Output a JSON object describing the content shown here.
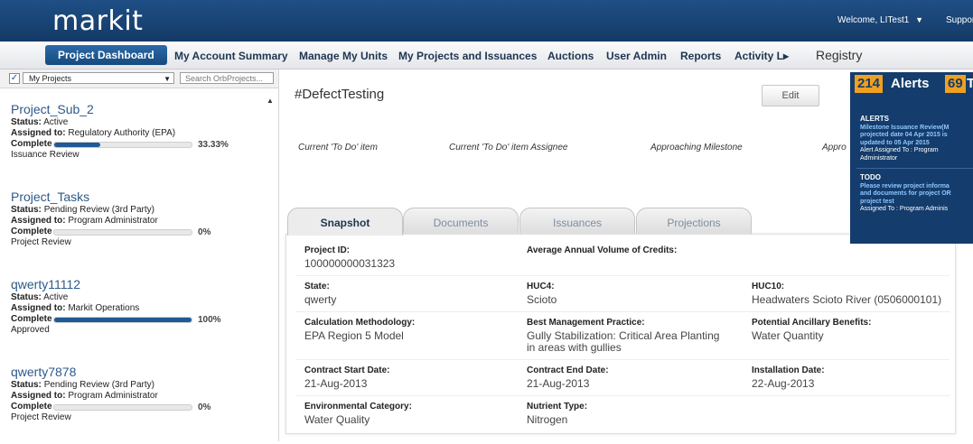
{
  "header": {
    "logo": "markit",
    "welcome": "Welcome, LITest1",
    "welcome_caret": "▼",
    "support": "Suppor"
  },
  "nav": {
    "items": [
      "Project Dashboard",
      "My Account Summary",
      "Manage My Units",
      "My Projects and Issuances",
      "Auctions",
      "User Admin",
      "Reports",
      "Activity L▸"
    ],
    "active": "Project Dashboard",
    "registry": "Registry"
  },
  "filter": {
    "checked": true,
    "select_value": "My Projects",
    "search_placeholder": "Search OrbProjects..."
  },
  "projects": [
    {
      "name": "Project_Sub_2",
      "status_label": "Status:",
      "status": "Active",
      "assigned_label": "Assigned to:",
      "assigned": "Regulatory Authority (EPA)",
      "complete_label": "Complete",
      "percent": "33.33%",
      "progress": 0.3333,
      "stage": "Issuance Review"
    },
    {
      "name": "Project_Tasks",
      "status_label": "Status:",
      "status": "Pending Review (3rd Party)",
      "assigned_label": "Assigned to:",
      "assigned": "Program Administrator",
      "complete_label": "Complete",
      "percent": "0%",
      "progress": 0,
      "stage": "Project Review"
    },
    {
      "name": "qwerty11112",
      "status_label": "Status:",
      "status": "Active",
      "assigned_label": "Assigned to:",
      "assigned": "Markit Operations",
      "complete_label": "Complete",
      "percent": "100%",
      "progress": 1,
      "stage": "Approved"
    },
    {
      "name": "qwerty7878",
      "status_label": "Status:",
      "status": "Pending Review (3rd Party)",
      "assigned_label": "Assigned to:",
      "assigned": "Program Administrator",
      "complete_label": "Complete",
      "percent": "0%",
      "progress": 0,
      "stage": "Project Review"
    }
  ],
  "main": {
    "title": "#DefectTesting",
    "edit_label": "Edit",
    "columns": [
      "Current 'To Do' item",
      "Current 'To Do' item Assignee",
      "Approaching Milestone",
      "Appro"
    ],
    "tabs": [
      "Snapshot",
      "Documents",
      "Issuances",
      "Projections"
    ],
    "active_tab": "Snapshot",
    "fields": {
      "project_id": {
        "label": "Project ID:",
        "value": "100000000031323"
      },
      "avg_volume": {
        "label": "Average Annual Volume of Credits:",
        "value": ""
      },
      "state": {
        "label": "State:",
        "value": "qwerty"
      },
      "huc4": {
        "label": "HUC4:",
        "value": "Scioto"
      },
      "huc10": {
        "label": "HUC10:",
        "value": "Headwaters Scioto River (0506000101)"
      },
      "calc_method": {
        "label": "Calculation Methodology:",
        "value": "EPA Region 5 Model"
      },
      "bmp": {
        "label": "Best Management Practice:",
        "value_line1": "Gully Stabilization: Critical Area Planting",
        "value_line2": "in areas with gullies"
      },
      "ancillary": {
        "label": "Potential Ancillary Benefits:",
        "value": "Water Quantity"
      },
      "contract_start": {
        "label": "Contract Start Date:",
        "value": "21-Aug-2013"
      },
      "contract_end": {
        "label": "Contract End Date:",
        "value": "21-Aug-2013"
      },
      "installation": {
        "label": "Installation Date:",
        "value": "22-Aug-2013"
      },
      "env_category": {
        "label": "Environmental Category:",
        "value": "Water Quality"
      },
      "nutrient": {
        "label": "Nutrient Type:",
        "value": "Nitrogen"
      }
    }
  },
  "alerts_panel": {
    "alerts_count": "214",
    "alerts_label": "Alerts",
    "todo_count": "69",
    "todo_label": "To",
    "alerts_section": {
      "header": "ALERTS",
      "line1": "Milestone Issuance Review(M",
      "line2": "projected date 04 Apr 2015 is",
      "line3": "updated to 05 Apr 2015",
      "line4": "Alert Assigned To : Program",
      "line5": "Administrator"
    },
    "todo_section": {
      "header": "TODO",
      "line1": "Please review project informa",
      "line2": "and documents for project OR",
      "line3": "project test",
      "line4": "Assigned To : Program Adminis"
    }
  }
}
